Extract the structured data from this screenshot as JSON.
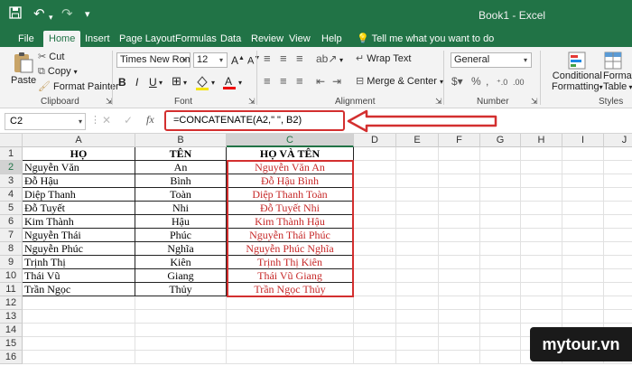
{
  "titlebar": {
    "book_title": "Book1  -  Excel"
  },
  "tabs": [
    "File",
    "Home",
    "Insert",
    "Page Layout",
    "Formulas",
    "Data",
    "Review",
    "View",
    "Help"
  ],
  "tell_me": "Tell me what you want to do",
  "ribbon": {
    "paste": "Paste",
    "cut": "Cut",
    "copy": "Copy",
    "format_painter": "Format Painter",
    "clipboard": "Clipboard",
    "font_name": "Times New Roman",
    "font_size": "12",
    "font": "Font",
    "wrap_text": "Wrap Text",
    "merge_center": "Merge & Center",
    "alignment": "Alignment",
    "number_format": "General",
    "number": "Number",
    "conditional_formatting": [
      "Conditional",
      "Formatting"
    ],
    "format_as_table": [
      "Format as",
      "Table"
    ],
    "styles": "Styles"
  },
  "formula_bar": {
    "name_box": "C2",
    "fx": "fx",
    "formula": "=CONCATENATE(A2,\" \", B2)"
  },
  "columns": [
    "A",
    "B",
    "C",
    "D",
    "E",
    "F",
    "G",
    "H",
    "I",
    "J"
  ],
  "rows": [
    "1",
    "2",
    "3",
    "4",
    "5",
    "6",
    "7",
    "8",
    "9",
    "10",
    "11",
    "12",
    "13",
    "14",
    "15",
    "16"
  ],
  "sheet": {
    "headers": [
      "HỌ",
      "TÊN",
      "HỌ VÀ TÊN"
    ],
    "data": [
      [
        "Nguyễn Văn",
        "An",
        "Nguyễn Văn An"
      ],
      [
        "Đỗ Hậu",
        "Bình",
        "Đỗ Hậu Bình"
      ],
      [
        "Diệp Thanh",
        "Toàn",
        "Diệp Thanh Toàn"
      ],
      [
        "Đỗ Tuyết",
        "Nhi",
        "Đỗ Tuyết Nhi"
      ],
      [
        "Kim Thành",
        "Hậu",
        "Kim Thành Hậu"
      ],
      [
        "Nguyễn Thái",
        "Phúc",
        "Nguyễn Thái Phúc"
      ],
      [
        "Nguyễn Phúc",
        "Nghĩa",
        "Nguyễn Phúc Nghĩa"
      ],
      [
        "Trịnh Thị",
        "Kiên",
        "Trịnh Thị Kiên"
      ],
      [
        "Thái Vũ",
        "Giang",
        "Thái Vũ Giang"
      ],
      [
        "Trần Ngọc",
        "Thủy",
        "Trần Ngọc Thủy"
      ]
    ]
  },
  "watermark": "mytour.vn",
  "colors": {
    "excel_green": "#217346",
    "highlight_red": "#d32f2f",
    "text_red": "#c62828"
  }
}
